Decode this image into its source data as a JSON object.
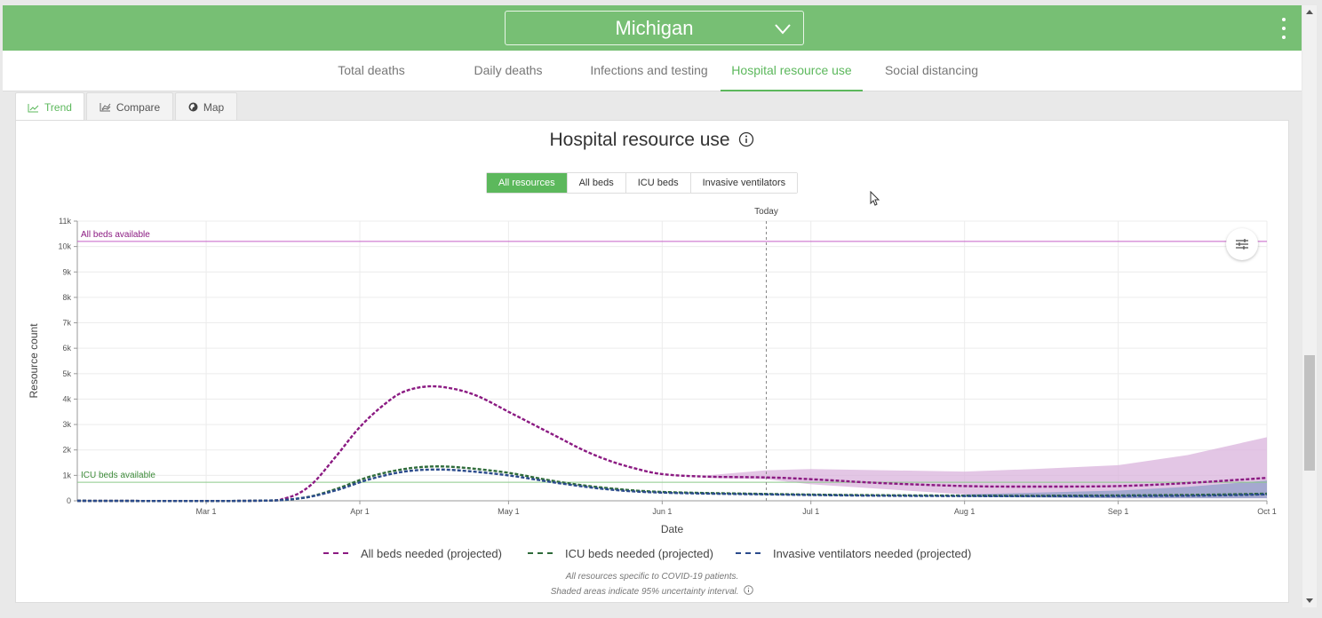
{
  "header": {
    "state": "Michigan"
  },
  "nav": {
    "tabs": [
      {
        "label": "Total deaths",
        "active": false
      },
      {
        "label": "Daily deaths",
        "active": false
      },
      {
        "label": "Infections and testing",
        "active": false
      },
      {
        "label": "Hospital resource use",
        "active": true
      },
      {
        "label": "Social distancing",
        "active": false
      }
    ]
  },
  "subtabs": [
    {
      "label": "Trend",
      "icon": "line-chart-icon",
      "active": true
    },
    {
      "label": "Compare",
      "icon": "compare-chart-icon",
      "active": false
    },
    {
      "label": "Map",
      "icon": "globe-icon",
      "active": false
    }
  ],
  "panel": {
    "title": "Hospital resource use",
    "resource_buttons": [
      {
        "label": "All resources",
        "active": true
      },
      {
        "label": "All beds",
        "active": false
      },
      {
        "label": "ICU beds",
        "active": false
      },
      {
        "label": "Invasive ventilators",
        "active": false
      }
    ],
    "footnote_1": "All resources specific to COVID-19 patients.",
    "footnote_2": "Shaded areas indicate 95% uncertainty interval."
  },
  "colors": {
    "header_green": "#77bf74",
    "accent_green": "#5cb85c",
    "all_beds": "#8b1a82",
    "icu_beds": "#2e6b3a",
    "ventilators": "#2b4b8c",
    "all_beds_band": "#d9b3dc",
    "ventilator_band": "#8a9cc8"
  },
  "chart_data": {
    "type": "line",
    "xlabel": "Date",
    "ylabel": "Resource count",
    "ylim": [
      0,
      11000
    ],
    "x_tick_labels": [
      "Mar 1",
      "Apr 1",
      "May 1",
      "Jun 1",
      "Jul 1",
      "Aug 1",
      "Sep 1",
      "Oct 1"
    ],
    "y_tick_labels": [
      "0",
      "1k",
      "2k",
      "3k",
      "4k",
      "5k",
      "6k",
      "7k",
      "8k",
      "9k",
      "10k",
      "11k"
    ],
    "x_range": [
      "2020-02-04",
      "2020-10-01"
    ],
    "today": {
      "label": "Today",
      "date": "2020-06-22"
    },
    "reference_lines": [
      {
        "label": "All beds available",
        "value": 10200
      },
      {
        "label": "ICU beds available",
        "value": 730
      }
    ],
    "series": [
      {
        "name": "All beds needed (projected)",
        "points": [
          [
            "2020-02-04",
            0
          ],
          [
            "2020-03-10",
            0
          ],
          [
            "2020-03-17",
            100
          ],
          [
            "2020-03-22",
            600
          ],
          [
            "2020-03-27",
            1700
          ],
          [
            "2020-04-01",
            2900
          ],
          [
            "2020-04-06",
            3800
          ],
          [
            "2020-04-10",
            4300
          ],
          [
            "2020-04-15",
            4500
          ],
          [
            "2020-04-20",
            4400
          ],
          [
            "2020-04-25",
            4100
          ],
          [
            "2020-05-01",
            3500
          ],
          [
            "2020-05-06",
            3000
          ],
          [
            "2020-05-11",
            2500
          ],
          [
            "2020-05-16",
            2000
          ],
          [
            "2020-05-21",
            1600
          ],
          [
            "2020-05-26",
            1300
          ],
          [
            "2020-06-01",
            1050
          ],
          [
            "2020-06-10",
            950
          ],
          [
            "2020-06-22",
            920
          ],
          [
            "2020-07-01",
            850
          ],
          [
            "2020-07-15",
            700
          ],
          [
            "2020-08-01",
            580
          ],
          [
            "2020-08-15",
            560
          ],
          [
            "2020-09-01",
            580
          ],
          [
            "2020-09-15",
            700
          ],
          [
            "2020-10-01",
            900
          ]
        ],
        "band_upper": [
          [
            "2020-06-10",
            1000
          ],
          [
            "2020-06-22",
            1200
          ],
          [
            "2020-07-01",
            1250
          ],
          [
            "2020-08-01",
            1150
          ],
          [
            "2020-08-15",
            1250
          ],
          [
            "2020-09-01",
            1400
          ],
          [
            "2020-09-15",
            1800
          ],
          [
            "2020-10-01",
            2500
          ]
        ],
        "band_lower": [
          [
            "2020-06-10",
            900
          ],
          [
            "2020-06-22",
            850
          ],
          [
            "2020-07-01",
            650
          ],
          [
            "2020-08-01",
            250
          ],
          [
            "2020-08-15",
            150
          ],
          [
            "2020-09-01",
            100
          ],
          [
            "2020-09-15",
            100
          ],
          [
            "2020-10-01",
            100
          ]
        ]
      },
      {
        "name": "ICU beds needed (projected)",
        "points": [
          [
            "2020-02-04",
            0
          ],
          [
            "2020-03-10",
            0
          ],
          [
            "2020-03-20",
            100
          ],
          [
            "2020-03-27",
            450
          ],
          [
            "2020-04-03",
            950
          ],
          [
            "2020-04-10",
            1250
          ],
          [
            "2020-04-16",
            1350
          ],
          [
            "2020-04-22",
            1300
          ],
          [
            "2020-05-01",
            1100
          ],
          [
            "2020-05-11",
            750
          ],
          [
            "2020-05-21",
            500
          ],
          [
            "2020-06-01",
            350
          ],
          [
            "2020-06-22",
            270
          ],
          [
            "2020-07-15",
            220
          ],
          [
            "2020-08-15",
            200
          ],
          [
            "2020-09-15",
            230
          ],
          [
            "2020-10-01",
            280
          ]
        ]
      },
      {
        "name": "Invasive ventilators needed (projected)",
        "points": [
          [
            "2020-02-04",
            0
          ],
          [
            "2020-03-10",
            0
          ],
          [
            "2020-03-20",
            100
          ],
          [
            "2020-03-27",
            400
          ],
          [
            "2020-04-03",
            850
          ],
          [
            "2020-04-10",
            1150
          ],
          [
            "2020-04-16",
            1230
          ],
          [
            "2020-04-22",
            1180
          ],
          [
            "2020-05-01",
            1000
          ],
          [
            "2020-05-11",
            700
          ],
          [
            "2020-05-21",
            450
          ],
          [
            "2020-06-01",
            320
          ],
          [
            "2020-06-22",
            250
          ],
          [
            "2020-07-15",
            200
          ],
          [
            "2020-08-15",
            180
          ],
          [
            "2020-09-15",
            200
          ],
          [
            "2020-10-01",
            250
          ]
        ],
        "band_upper": [
          [
            "2020-08-01",
            250
          ],
          [
            "2020-09-01",
            400
          ],
          [
            "2020-09-15",
            550
          ],
          [
            "2020-10-01",
            800
          ]
        ],
        "band_lower": [
          [
            "2020-08-01",
            150
          ],
          [
            "2020-09-01",
            100
          ],
          [
            "2020-09-15",
            100
          ],
          [
            "2020-10-01",
            100
          ]
        ]
      }
    ]
  }
}
